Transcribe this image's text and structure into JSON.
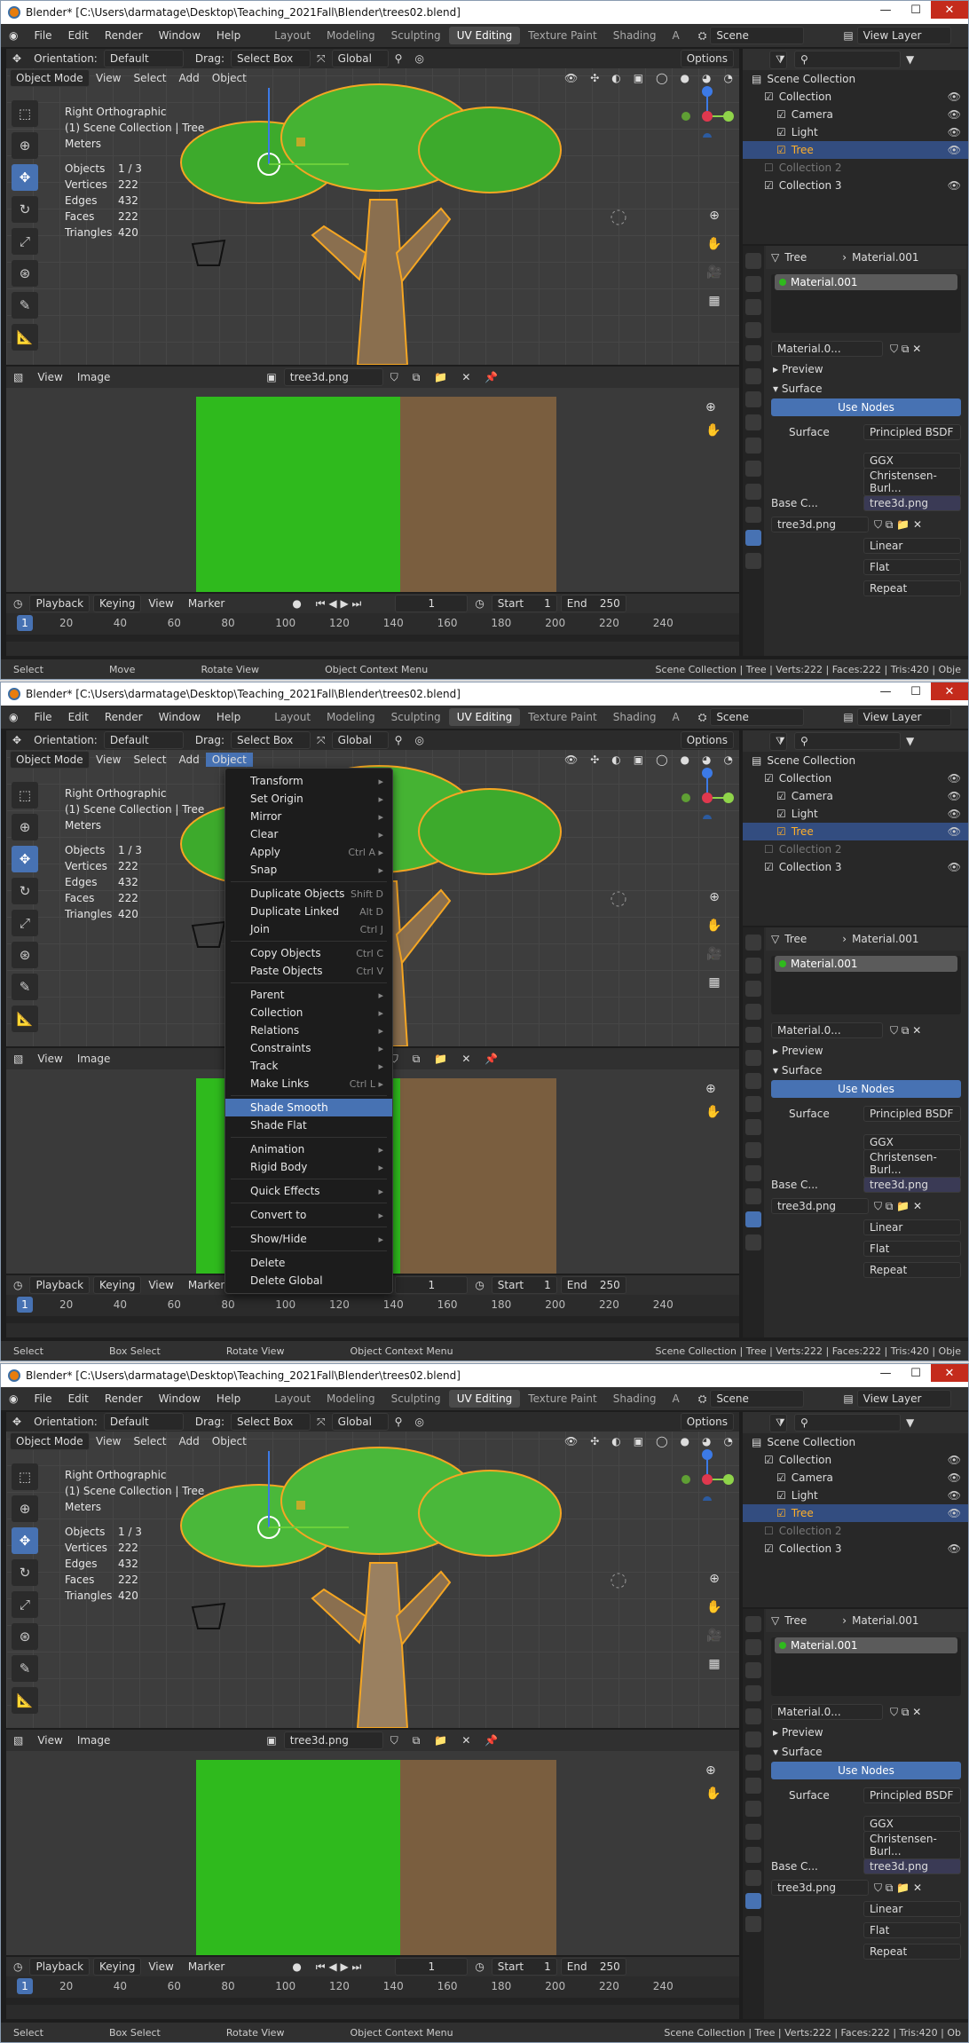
{
  "window": {
    "title": "Blender* [C:\\Users\\darmatage\\Desktop\\Teaching_2021Fall\\Blender\\trees02.blend]",
    "controls": [
      "—",
      "☐",
      "✕"
    ]
  },
  "topbar": {
    "menus": [
      "File",
      "Edit",
      "Render",
      "Window",
      "Help"
    ],
    "workspaces": [
      "Layout",
      "Modeling",
      "Sculpting",
      "UV Editing",
      "Texture Paint",
      "Shading",
      "A"
    ],
    "active_workspace": "UV Editing",
    "scene": "Scene",
    "view_layer": "View Layer"
  },
  "toolbar": {
    "orientation_label": "Orientation:",
    "orientation_value": "Default",
    "drag_label": "Drag:",
    "drag_value": "Select Box",
    "transform_value": "Global",
    "options": "Options"
  },
  "viewport": {
    "mode": "Object Mode",
    "menus": [
      "View",
      "Select",
      "Add",
      "Object"
    ],
    "view_name": "Right Orthographic",
    "collection_line": "(1) Scene Collection | Tree",
    "units": "Meters",
    "stats": [
      {
        "k": "Objects",
        "v": "1 / 3"
      },
      {
        "k": "Vertices",
        "v": "222"
      },
      {
        "k": "Edges",
        "v": "432"
      },
      {
        "k": "Faces",
        "v": "222"
      },
      {
        "k": "Triangles",
        "v": "420"
      }
    ]
  },
  "uv_editor": {
    "menus": [
      "View",
      "Image"
    ],
    "image_name": "tree3d.png",
    "colors": {
      "green": "#2fba1d",
      "brown": "#7a5e3f"
    }
  },
  "timeline": {
    "menus": [
      "Playback",
      "Keying",
      "View",
      "Marker"
    ],
    "current_frame": "1",
    "start_label": "Start",
    "start": "1",
    "end_label": "End",
    "end": "250",
    "ticks": [
      "20",
      "40",
      "60",
      "80",
      "100",
      "120",
      "140",
      "160",
      "180",
      "200",
      "220",
      "240"
    ],
    "frame_marker": "1"
  },
  "status": {
    "select": "Select",
    "move": "Move",
    "box_select": "Box Select",
    "rotate": "Rotate View",
    "context": "Object Context Menu",
    "info": "Scene Collection | Tree | Verts:222 | Faces:222 | Tris:420 | Obje",
    "info_short": "Scene Collection | Tree | Verts:222 | Faces:222 | Tris:420 | Ob"
  },
  "outliner": {
    "items": [
      {
        "label": "Scene Collection",
        "indent": 0,
        "state": ""
      },
      {
        "label": "Collection",
        "indent": 1,
        "state": ""
      },
      {
        "label": "Camera",
        "indent": 2,
        "state": ""
      },
      {
        "label": "Light",
        "indent": 2,
        "state": ""
      },
      {
        "label": "Tree",
        "indent": 2,
        "state": "sel"
      },
      {
        "label": "Collection 2",
        "indent": 1,
        "state": "dim"
      },
      {
        "label": "Collection 3",
        "indent": 1,
        "state": ""
      }
    ]
  },
  "properties": {
    "object": "Tree",
    "material": "Material.001",
    "material_short": "Material.0...",
    "preview": "Preview",
    "surface_panel": "Surface",
    "use_nodes": "Use Nodes",
    "surface_label": "Surface",
    "surface_value": "Principled BSDF",
    "distribution": "GGX",
    "subsurface": "Christensen-Burl...",
    "base_color_label": "Base C...",
    "base_color_value": "tree3d.png",
    "image": "tree3d.png",
    "interp": "Linear",
    "projection": "Flat",
    "extension": "Repeat"
  },
  "context_menu": {
    "groups": [
      [
        {
          "label": "Transform",
          "sc": "▸"
        },
        {
          "label": "Set Origin",
          "sc": "▸"
        },
        {
          "label": "Mirror",
          "sc": "▸"
        },
        {
          "label": "Clear",
          "sc": "▸"
        },
        {
          "label": "Apply",
          "sc": "Ctrl A ▸"
        },
        {
          "label": "Snap",
          "sc": "▸"
        }
      ],
      [
        {
          "label": "Duplicate Objects",
          "sc": "Shift D"
        },
        {
          "label": "Duplicate Linked",
          "sc": "Alt D"
        },
        {
          "label": "Join",
          "sc": "Ctrl J"
        }
      ],
      [
        {
          "label": "Copy Objects",
          "sc": "Ctrl C"
        },
        {
          "label": "Paste Objects",
          "sc": "Ctrl V"
        }
      ],
      [
        {
          "label": "Parent",
          "sc": "▸"
        },
        {
          "label": "Collection",
          "sc": "▸"
        },
        {
          "label": "Relations",
          "sc": "▸"
        },
        {
          "label": "Constraints",
          "sc": "▸"
        },
        {
          "label": "Track",
          "sc": "▸"
        },
        {
          "label": "Make Links",
          "sc": "Ctrl L ▸"
        }
      ],
      [
        {
          "label": "Shade Smooth",
          "sc": "",
          "hl": true
        },
        {
          "label": "Shade Flat",
          "sc": ""
        }
      ],
      [
        {
          "label": "Animation",
          "sc": "▸"
        },
        {
          "label": "Rigid Body",
          "sc": "▸"
        }
      ],
      [
        {
          "label": "Quick Effects",
          "sc": "▸"
        }
      ],
      [
        {
          "label": "Convert to",
          "sc": "▸"
        }
      ],
      [
        {
          "label": "Show/Hide",
          "sc": "▸"
        }
      ],
      [
        {
          "label": "Delete",
          "sc": ""
        },
        {
          "label": "Delete Global",
          "sc": ""
        }
      ]
    ]
  }
}
